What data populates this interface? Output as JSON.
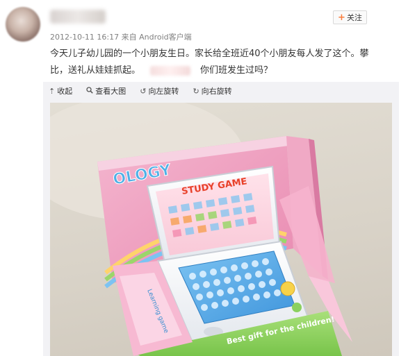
{
  "post": {
    "timestamp": "2012-10-11 16:17",
    "source": "来自 Android客户端",
    "follow_label": "关注",
    "text_line1": "今天儿子幼儿园的一个小朋友生日。家长给全班近40个小朋友每人发了这个。攀",
    "text_line2_a": "比，送礼从娃娃抓起。",
    "text_line2_b": "你们班发生过吗？"
  },
  "toolbar": {
    "collapse": "收起",
    "view_large": "查看大图",
    "rotate_left": "向左旋转",
    "rotate_right": "向右旋转"
  },
  "photo": {
    "box_brand": "OLOGY",
    "screen_title": "STUDY GAME",
    "side_label": "Learning game",
    "front_slogan": "Best gift for the children!"
  },
  "icons": {
    "collapse": "arrow-up-icon",
    "view_large": "magnifier-icon",
    "rotate_left": "rotate-left-icon",
    "rotate_right": "rotate-right-icon",
    "follow": "plus-icon"
  },
  "colors": {
    "accent": "#fa7d3c",
    "muted": "#808080",
    "panel": "#f2f2f5"
  }
}
